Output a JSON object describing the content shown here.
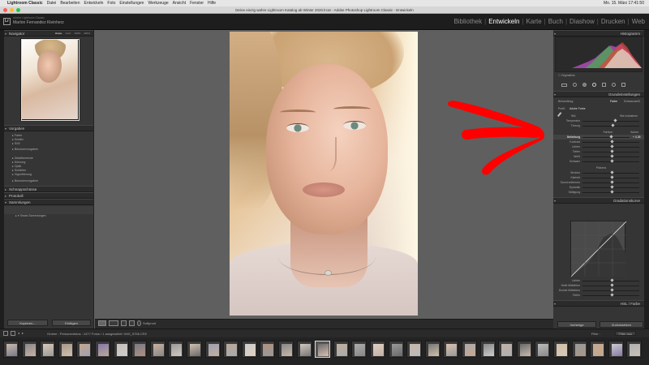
{
  "menubar": {
    "apple": "",
    "items": [
      "Lightroom Classic",
      "Datei",
      "Bearbeiten",
      "Entwickeln",
      "Foto",
      "Einstellungen",
      "Werkzeuge",
      "Ansicht",
      "Fenster",
      "Hilfe"
    ],
    "clock": "Mo. 15. März  17:41:50"
  },
  "window": {
    "title": "Deine einzig wahre Lightroom Katalog ab Winter 2020.lrcat - Adobe Photoshop Lightroom Classic - Entwickeln",
    "traffic_colors": [
      "#fe5f57",
      "#febc2e",
      "#28c840"
    ]
  },
  "identity": {
    "logo": "Lr",
    "small": "Adobe Lightroom Classic",
    "name": "Marlon Fernandez Kleinherz"
  },
  "modules": [
    {
      "label": "Bibliothek",
      "active": false
    },
    {
      "label": "Entwickeln",
      "active": true
    },
    {
      "label": "Karte",
      "active": false
    },
    {
      "label": "Buch",
      "active": false
    },
    {
      "label": "Diashow",
      "active": false
    },
    {
      "label": "Drucken",
      "active": false
    },
    {
      "label": "Web",
      "active": false
    }
  ],
  "left": {
    "navigator": {
      "title": "Navigator",
      "zoom": [
        "Einpa.",
        "Ausf.",
        "100%",
        "200%"
      ]
    },
    "presets": {
      "title": "Vorgaben",
      "items": [
        "Farbe",
        "Kreativ",
        "S/W",
        "Benutzervorgaben",
        "Detailbereiche",
        "Körnung",
        "Optik",
        "Schärfen",
        "Vignettierung",
        "Benutzervorgaben"
      ]
    },
    "snapshots": {
      "title": "Schnappschüsse"
    },
    "history": {
      "title": "Protokoll"
    },
    "collections": {
      "title": "Sammlungen",
      "item": "Smart-Sammlungen"
    },
    "buttons": {
      "copy": "Kopieren...",
      "paste": "Einfügen"
    }
  },
  "center": {
    "softproof": "Softproof"
  },
  "right": {
    "histogram": {
      "title": "Histogramm",
      "label": "Originalfoto"
    },
    "basic": {
      "title": "Grundeinstellungen",
      "treatment": "Behandlung:",
      "color": "Farbe",
      "bw": "Schwarzweiß",
      "profile": "Profil:",
      "profile_value": "Adobe Farbe",
      "wb": "WA:",
      "wb_value": "Wie Aufnahme",
      "sliders1": [
        {
          "label": "Temperatur",
          "pos": 0.55
        },
        {
          "label": "Tönung",
          "pos": 0.52
        }
      ],
      "tone_header": "Farbton",
      "auto": "Autom.",
      "exposure_label": "Belichtung",
      "exposure_value": "+ 0,35",
      "sliders2": [
        {
          "label": "Kontrast",
          "pos": 0.5
        },
        {
          "label": "Lichter",
          "pos": 0.5
        },
        {
          "label": "Tiefen",
          "pos": 0.5
        },
        {
          "label": "Weiß",
          "pos": 0.5
        },
        {
          "label": "Schwarz",
          "pos": 0.5
        }
      ],
      "presence_header": "Präsenz",
      "sliders3": [
        {
          "label": "Struktur",
          "pos": 0.5
        },
        {
          "label": "Klarheit",
          "pos": 0.5
        },
        {
          "label": "Dunst entfernen",
          "pos": 0.5
        },
        {
          "label": "Dynamik",
          "pos": 0.5
        },
        {
          "label": "Sättigung",
          "pos": 0.5
        }
      ]
    },
    "tonecurve": {
      "title": "Gradationskurve",
      "region": "Bereich",
      "sliders": [
        {
          "label": "Lichter",
          "pos": 0.5
        },
        {
          "label": "Helle Mitteltöne",
          "pos": 0.5
        },
        {
          "label": "Dunkle Mitteltöne",
          "pos": 0.5
        },
        {
          "label": "Tiefen",
          "pos": 0.5
        }
      ]
    },
    "hsl": {
      "title": "HSL / Farbe"
    },
    "buttons": {
      "prev": "Vorherige",
      "reset": "Zurücksetzen"
    }
  },
  "filmstrip": {
    "source": "Ordner : Personenfotos : 1477 Fotos / 1 ausgewählt / IMG_5756.CR2",
    "filter": "Filter :",
    "filter_value": "Filter aus"
  }
}
